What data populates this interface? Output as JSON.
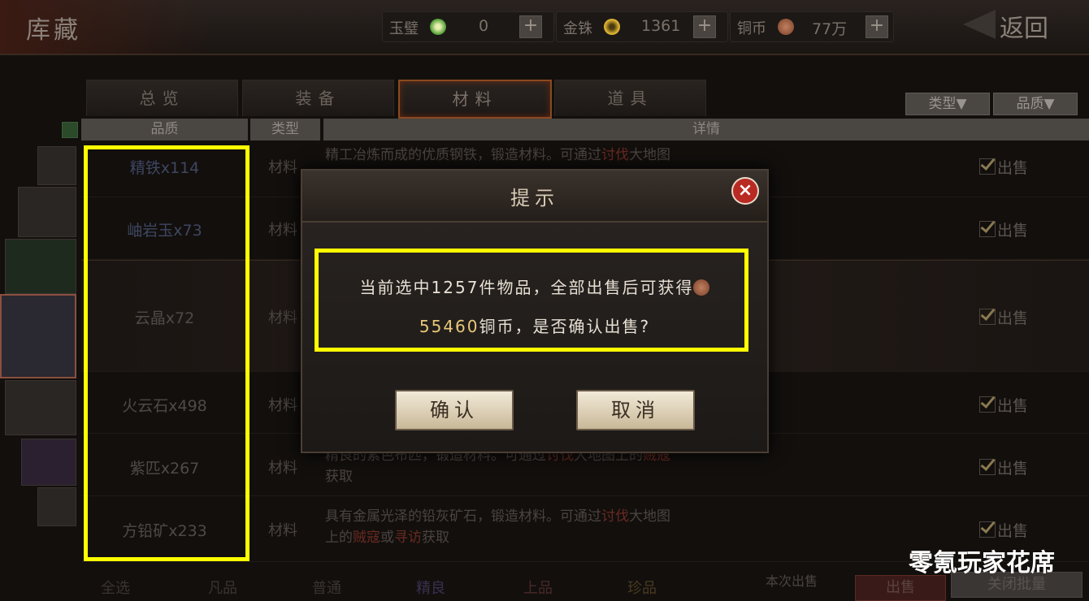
{
  "header": {
    "title": "库藏",
    "back_label": "返回"
  },
  "currencies": [
    {
      "label": "玉璧",
      "value": "0"
    },
    {
      "label": "金铢",
      "value": "1361"
    },
    {
      "label": "铜币",
      "value": "77万"
    }
  ],
  "plus_label": "+",
  "tabs": [
    {
      "label": "总览"
    },
    {
      "label": "装备"
    },
    {
      "label": "材料"
    },
    {
      "label": "道具"
    }
  ],
  "filters": {
    "type": "类型▼",
    "quality": "品质▼"
  },
  "columns": {
    "quality": "品质",
    "type": "类型",
    "detail": "详情"
  },
  "rows": [
    {
      "name": "精铁x114",
      "type": "材料",
      "desc1": "精工冶炼而成的优质钢铁，锻造材料。可通过",
      "desc_hl": "讨伐",
      "desc2": "大地图",
      "sell": "出售"
    },
    {
      "name": "岫岩玉x73",
      "type": "材料",
      "desc1": "",
      "desc_hl": "",
      "desc2": "",
      "sell": "出售"
    },
    {
      "name": "云晶x72",
      "type": "材料",
      "desc1": "",
      "desc_hl": "",
      "desc2": "",
      "sell": "出售"
    },
    {
      "name": "火云石x498",
      "type": "材料",
      "desc1": "",
      "desc_hl": "",
      "desc2": "",
      "sell": "出售"
    },
    {
      "name": "紫匹x267",
      "type": "材料",
      "desc1": "精良的紫色布匹，锻造材料。可通过",
      "desc_hl": "讨伐",
      "desc2": "大地图上的",
      "desc_hl2": "贼寇",
      "desc3": "获取",
      "sell": "出售"
    },
    {
      "name": "方铅矿x233",
      "type": "材料",
      "desc1": "具有金属光泽的铅灰矿石，锻造材料。可通过",
      "desc_hl": "讨伐",
      "desc2": "大地图",
      "desc_line2a": "上的",
      "desc_hl2": "贼寇",
      "desc_or": "或",
      "desc_hl3": "寻访",
      "desc3": "获取",
      "sell": "出售"
    }
  ],
  "modal": {
    "title": "提示",
    "close": "×",
    "line1": "当前选中1257件物品，全部出售后可获得",
    "amount": "55460",
    "line2": "铜币，是否确认出售?",
    "confirm": "确认",
    "cancel": "取消"
  },
  "bottom": {
    "select_all": "全选",
    "quality_a": "凡品",
    "quality_b": "普通",
    "quality_c": "精良",
    "quality_d": "上品",
    "quality_e": "珍品",
    "this_sale": "本次出售",
    "sell_btn": "出售",
    "close_btn": "关闭批量"
  },
  "watermark": "零氪玩家花席",
  "colors": {
    "highlight_box": "#ffff00",
    "close_red": "#b82a22",
    "gold": "#e8c878"
  }
}
